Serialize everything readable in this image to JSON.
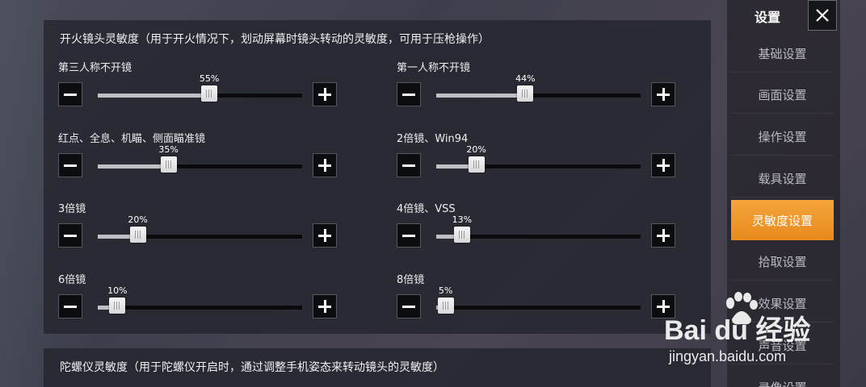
{
  "sidebar": {
    "title": "设置",
    "close_icon": "close-icon",
    "items": [
      {
        "label": "基础设置",
        "active": false
      },
      {
        "label": "画面设置",
        "active": false
      },
      {
        "label": "操作设置",
        "active": false
      },
      {
        "label": "载具设置",
        "active": false
      },
      {
        "label": "灵敏度设置",
        "active": true
      },
      {
        "label": "拾取设置",
        "active": false
      },
      {
        "label": "效果设置",
        "active": false
      },
      {
        "label": "声音设置",
        "active": false
      },
      {
        "label": "录像设置",
        "active": false
      }
    ]
  },
  "fire_scope": {
    "title": "开火镜头灵敏度（用于开火情况下，划动屏幕时镜头转动的灵敏度，可用于压枪操作）",
    "sliders": [
      {
        "label": "第三人称不开镜",
        "value": 55,
        "display": "55%"
      },
      {
        "label": "第一人称不开镜",
        "value": 44,
        "display": "44%"
      },
      {
        "label": "红点、全息、机瞄、侧面瞄准镜",
        "value": 35,
        "display": "35%"
      },
      {
        "label": "2倍镜、Win94",
        "value": 20,
        "display": "20%"
      },
      {
        "label": "3倍镜",
        "value": 20,
        "display": "20%"
      },
      {
        "label": "4倍镜、VSS",
        "value": 13,
        "display": "13%"
      },
      {
        "label": "6倍镜",
        "value": 10,
        "display": "10%"
      },
      {
        "label": "8倍镜",
        "value": 5,
        "display": "5%"
      }
    ]
  },
  "gyro": {
    "title": "陀螺仪灵敏度（用于陀螺仪开启时，通过调整手机姿态来转动镜头的灵敏度）"
  },
  "watermark": {
    "text": "Bai du 经验",
    "sub": "jingyan.baidu.com"
  },
  "colors": {
    "accent": "#f09a2c",
    "panel": "#1e212a",
    "button": "#0c0d10"
  }
}
